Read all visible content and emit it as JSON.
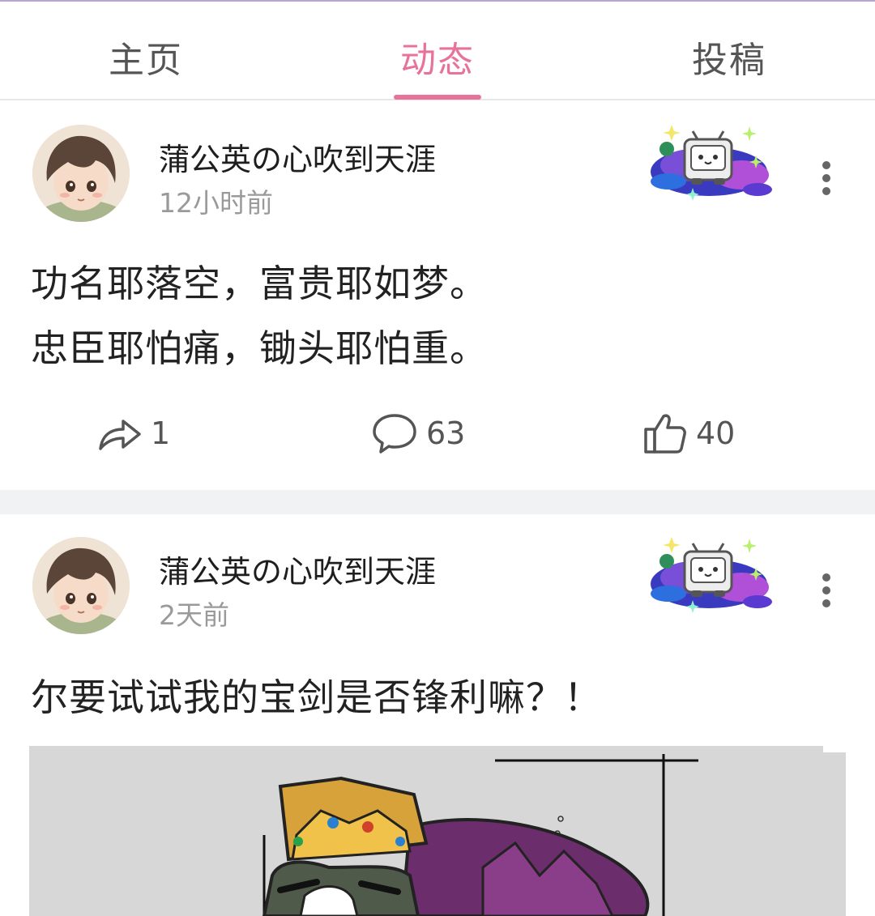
{
  "tabs": [
    {
      "label": "主页",
      "active": false
    },
    {
      "label": "动态",
      "active": true
    },
    {
      "label": "投稿",
      "active": false
    }
  ],
  "accent_color": "#e8739a",
  "posts": [
    {
      "username": "蒲公英の心吹到天涯",
      "time": "12小时前",
      "lines": [
        "功名耶落空，富贵耶如梦。",
        "忠臣耶怕痛，锄头耶怕重。"
      ],
      "actions": {
        "share": "1",
        "comment": "63",
        "like": "40"
      }
    },
    {
      "username": "蒲公英の心吹到天涯",
      "time": "2天前",
      "lines": [
        "尔要试试我的宝剑是否锋利嘛？！"
      ]
    }
  ],
  "icons": {
    "share": "share-arrow-icon",
    "comment": "speech-bubble-icon",
    "like": "thumbs-up-icon",
    "more": "vertical-dots-icon"
  }
}
